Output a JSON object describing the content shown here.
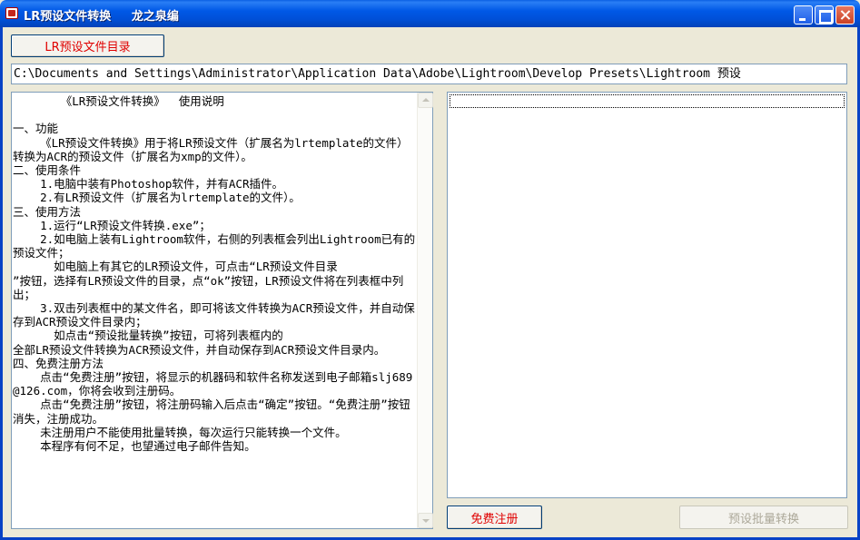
{
  "window": {
    "title": "LR预设文件转换     龙之泉编"
  },
  "toolbar": {
    "dir_button_label": "LR预设文件目录"
  },
  "path": {
    "value": "C:\\Documents and Settings\\Administrator\\Application Data\\Adobe\\Lightroom\\Develop Presets\\Lightroom 预设"
  },
  "instructions": {
    "text": "       《LR预设文件转换》  使用说明\n\n一、功能\n    《LR预设文件转换》用于将LR预设文件（扩展名为lrtemplate的文件）转换为ACR的预设文件（扩展名为xmp的文件）。\n二、使用条件\n    1.电脑中装有Photoshop软件，并有ACR插件。\n    2.有LR预设文件（扩展名为lrtemplate的文件）。\n三、使用方法\n    1.运行“LR预设文件转换.exe”；\n    2.如电脑上装有Lightroom软件，右侧的列表框会列出Lightroom已有的预设文件；\n      如电脑上有其它的LR预设文件，可点击“LR预设文件目录\n”按钮，选择有LR预设文件的目录，点“ok”按钮，LR预设文件将在列表框中列出；\n    3.双击列表框中的某文件名，即可将该文件转换为ACR预设文件，并自动保存到ACR预设文件目录内；\n      如点击“预设批量转换”按钮，可将列表框内的\n全部LR预设文件转换为ACR预设文件，并自动保存到ACR预设文件目录内。\n四、免费注册方法\n    点击“免费注册”按钮，将显示的机器码和软件名称发送到电子邮箱slj689@126.com，你将会收到注册码。\n    点击“免费注册”按钮，将注册码输入后点击“确定”按钮。“免费注册”按钮消失，注册成功。\n    未注册用户不能使用批量转换，每次运行只能转换一个文件。\n    本程序有何不足，也望通过电子邮件告知。"
  },
  "buttons": {
    "register_label": "免费注册",
    "batch_label": "预设批量转换"
  },
  "colors": {
    "button_text": "#e00000",
    "disabled_text": "#aca899",
    "titlebar": "#0058e6"
  }
}
